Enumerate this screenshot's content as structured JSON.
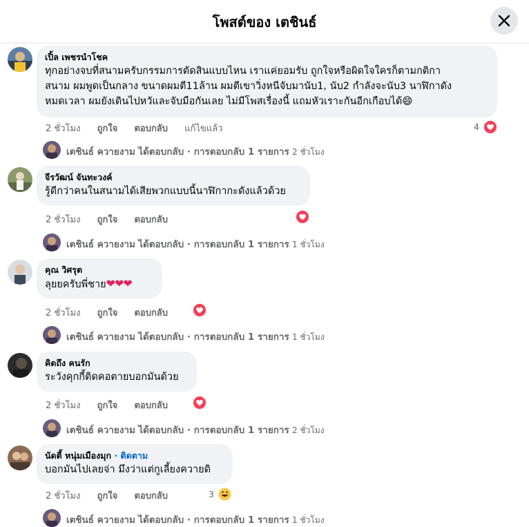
{
  "header": {
    "title": "โพสต์ของ เตชินธ์",
    "close_icon": "close-icon"
  },
  "comments": [
    {
      "author": "เปิ้ล เพชรนำโชค",
      "text_lines": [
        "ทุกอย่างจบที่สนามครับกรรมการตัดสินแบบไหน เราแค่ยอมรับ ถูกใจหรือผิดใจใครก็ตามกติกา",
        "สนาม ผมพูดเป็นกลาง ขนาดผมตี11ล้าน ผมตีเขาวิ่งหนีจับมานับ1, นับ2 กำลังจะนับ3 นาฬิกาดัง",
        "หมดเวลา ผมยังเดินไปหวัและจับมือกันเลย ไม่มีโพสเรื่องนี้ แถมหัวเราะกันอีกเกือบได้😄"
      ],
      "time": "2 ชั่วโมง",
      "like": "ถูกใจ",
      "reply": "ตอบกลับ",
      "edit": "แก้ไขแล้ว",
      "reaction_count": "4",
      "reply_summary": {
        "name": "เตชินธ์ ควายงาม",
        "text": "ได้ตอบกลับ · การตอบกลับ 1 รายการ",
        "time": "2 ชั่วโมง"
      }
    },
    {
      "author": "จีรวัฒน์ จันทะวงค์",
      "text_lines": [
        "รู้ดีกว่าคนในสนามได้เสียพวกแบบนี้นาฬิกากะดังแล้วด้วย"
      ],
      "time": "2 ชั่วโมง",
      "like": "ถูกใจ",
      "reply": "ตอบกลับ",
      "reply_summary": {
        "name": "เตชินธ์ ควายงาม",
        "text": "ได้ตอบกลับ · การตอบกลับ 1 รายการ",
        "time": "1 ชั่วโมง"
      }
    },
    {
      "author": "คุณ วิศรุต",
      "text": "ลุยยครับพี่ชาย",
      "text_hearts": "❤❤❤",
      "time": "2 ชั่วโมง",
      "like": "ถูกใจ",
      "reply": "ตอบกลับ",
      "reply_summary": {
        "name": "เตชินธ์ ควายงาม",
        "text": "ได้ตอบกลับ · การตอบกลับ 1 รายการ",
        "time": "1 ชั่วโมง"
      }
    },
    {
      "author": "คิดถึง คนรัก",
      "text_lines": [
        "ระวังคุกกี้ติดคอตายบอกมันด้วย"
      ],
      "time": "2 ชั่วโมง",
      "like": "ถูกใจ",
      "reply": "ตอบกลับ",
      "reply_summary": {
        "name": "เตชินธ์ ควายงาม",
        "text": "ได้ตอบกลับ · การตอบกลับ 1 รายการ",
        "time": "2 ชั่วโมง"
      }
    },
    {
      "author": "นัดตี้ หนุ่มเมืองมุก",
      "follow": "· ติดตาม",
      "text_lines": [
        "บอกมันไปเลยจ่า มึงว่าแต่กูเลี้ยงควายดิ"
      ],
      "time": "2 ชั่วโมง",
      "like": "ถูกใจ",
      "reply": "ตอบกลับ",
      "reaction_count": "3",
      "reply_summary": {
        "name": "เตชินธ์ ควายงาม",
        "text": "ได้ตอบกลับ · การตอบกลับ 1 รายการ",
        "time": "1 ชั่วโมง"
      }
    }
  ],
  "colors": {
    "bubble": "#f0f2f5",
    "heart": "#f33e58",
    "secondary_text": "#65676b",
    "link": "#0064d1"
  }
}
